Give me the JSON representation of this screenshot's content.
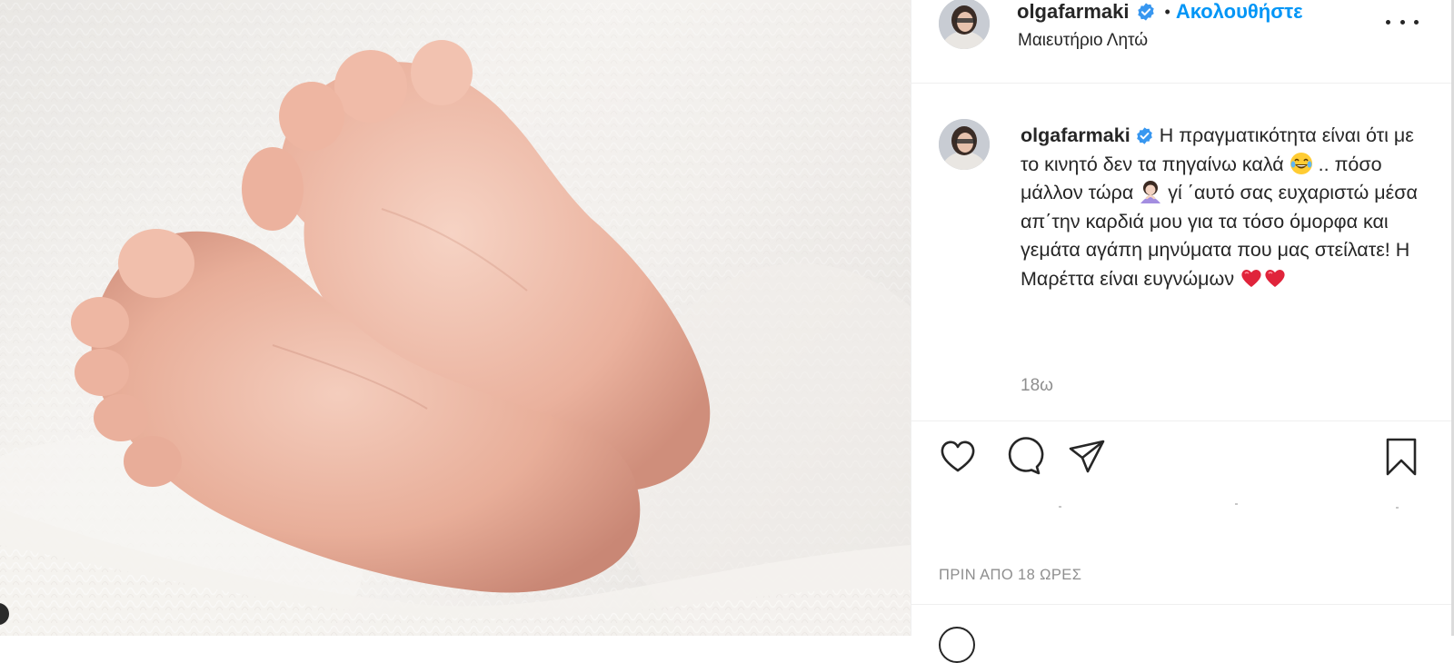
{
  "post": {
    "username": "olgafarmaki",
    "follow_label": "Ακολουθήστε",
    "dot_separator": "•",
    "location": "Μαιευτήριο Λητώ",
    "caption_text": "Η πραγματικότητα είναι ότι με το κινητό δεν τα πηγαίνω καλά 😂 .. πόσο μάλλον τώρα 🙇🏻‍♀️ γί ΄αυτό σας ευχαριστώ μέσα απ΄την καρδιά μου για τα τόσο όμορφα και γεμάτα αγάπη μηνύματα που μας στείλατε! Η Μαρέττα είναι ευγνώμων ❤️❤️",
    "caption_parts": {
      "part1": "Η πραγματικότητα είναι ότι με το κινητό δεν τα πηγαίνω καλά",
      "part2": ".. πόσο μάλλον τώρα",
      "part3": "γί ΄αυτό σας ευχαριστώ μέσα απ΄την καρδιά μου για τα τόσο όμορφα και γεμάτα αγάπη μηνύματα που μας στείλατε! Η Μαρέττα είναι ευγνώμων"
    },
    "time_ago": "18ω",
    "posted_label": "ΠΡΙΝ ΑΠΟ 18 ΩΡΕΣ"
  },
  "icons": {
    "verified": "verified-badge-icon",
    "more": "more-options-icon",
    "like": "heart-icon",
    "comment": "comment-bubble-icon",
    "share": "paper-plane-icon",
    "save": "bookmark-icon",
    "emoji_laugh": "tears-of-joy-emoji",
    "emoji_bow": "woman-bowing-emoji",
    "emoji_heart": "red-heart-emoji"
  },
  "colors": {
    "link_blue": "#0095f6",
    "verified_blue": "#3897f0",
    "text": "#262626",
    "muted": "#8e8e8e",
    "divider": "#efefef"
  }
}
